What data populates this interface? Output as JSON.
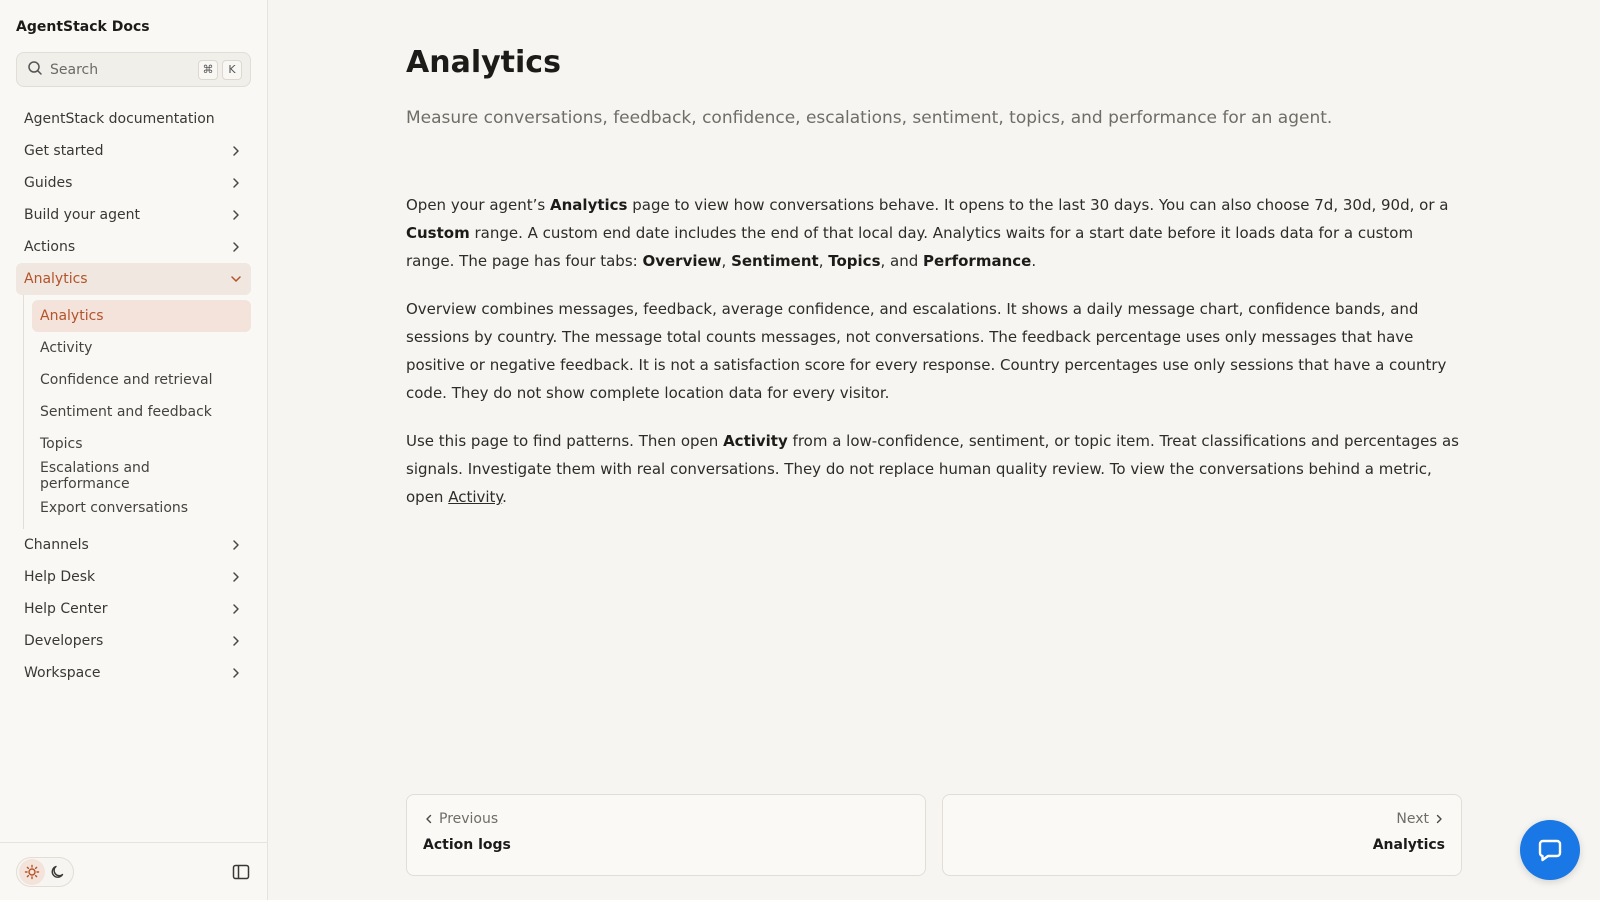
{
  "sidebar": {
    "brand": "AgentStack Docs",
    "search": {
      "placeholder": "Search",
      "shortcut_mod": "⌘",
      "shortcut_key": "K"
    },
    "items": [
      {
        "label": "AgentStack documentation",
        "chevron": false
      },
      {
        "label": "Get started",
        "chevron": true
      },
      {
        "label": "Guides",
        "chevron": true
      },
      {
        "label": "Build your agent",
        "chevron": true
      },
      {
        "label": "Actions",
        "chevron": true
      },
      {
        "label": "Analytics",
        "chevron": true,
        "expanded": true
      }
    ],
    "sub_items": [
      {
        "label": "Analytics",
        "active": true
      },
      {
        "label": "Activity"
      },
      {
        "label": "Confidence and retrieval"
      },
      {
        "label": "Sentiment and feedback"
      },
      {
        "label": "Topics"
      },
      {
        "label": "Escalations and performance"
      },
      {
        "label": "Export conversations"
      }
    ],
    "items_after": [
      {
        "label": "Channels"
      },
      {
        "label": "Help Desk"
      },
      {
        "label": "Help Center"
      },
      {
        "label": "Developers"
      },
      {
        "label": "Workspace"
      }
    ]
  },
  "page": {
    "title": "Analytics",
    "subtitle": "Measure conversations, feedback, confidence, escalations, sentiment, topics, and performance for an agent.",
    "p1": {
      "a": "Open your agent’s ",
      "b1": "Analytics",
      "c": " page to view how conversations behave. It opens to the last 30 days. You can also choose 7d, 30d, 90d, or a ",
      "b2": "Custom",
      "d": " range. A custom end date includes the end of that local day. Analytics waits for a start date before it loads data for a custom range. The page has four tabs: ",
      "t1": "Overview",
      "s1": ", ",
      "t2": "Sentiment",
      "s2": ", ",
      "t3": "Topics",
      "s3": ", and ",
      "t4": "Performance",
      "e": "."
    },
    "p2": "Overview combines messages, feedback, average confidence, and escalations. It shows a daily message chart, confidence bands, and sessions by country. The message total counts messages, not conversations. The feedback percentage uses only messages that have positive or negative feedback. It is not a satisfaction score for every response. Country percentages use only sessions that have a country code. They do not show complete location data for every visitor.",
    "p3": {
      "a": "Use this page to find patterns. Then open ",
      "b": "Activity",
      "c": " from a low-confidence, sentiment, or topic item. Treat classifications and percentages as signals. Investigate them with real conversations. They do not replace human quality review. To view the conversations behind a metric, open ",
      "link": "Activity",
      "d": "."
    }
  },
  "pager": {
    "prev_label": "Previous",
    "prev_title": "Action logs",
    "next_label": "Next",
    "next_title": "Analytics"
  },
  "colors": {
    "accent": "#b4532a",
    "fab": "#1977e6"
  }
}
